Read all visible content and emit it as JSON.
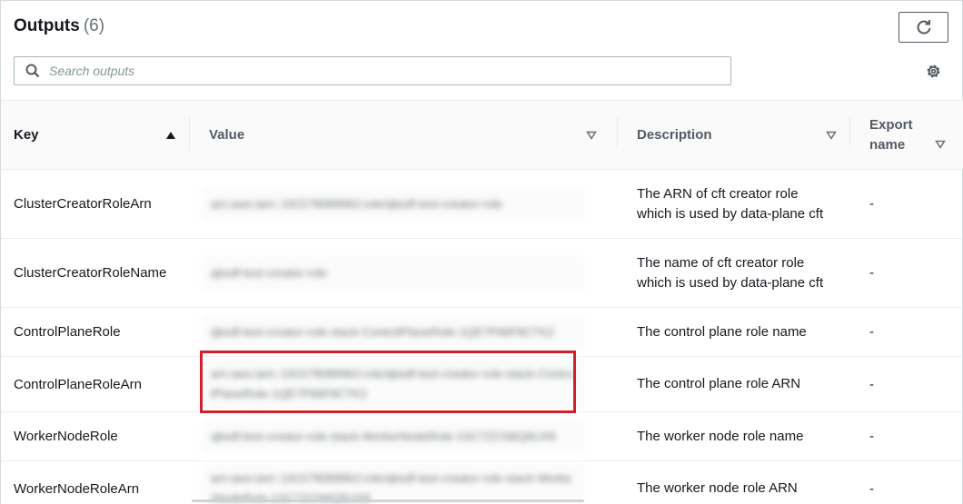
{
  "header": {
    "title": "Outputs",
    "count": "(6)"
  },
  "search": {
    "placeholder": "Search outputs",
    "value": ""
  },
  "icons": {
    "refresh": "refresh-icon",
    "search": "search-icon",
    "settings": "gear-icon",
    "sort_asc": "caret-up-icon",
    "sort_none": "caret-down-outline-icon"
  },
  "colors": {
    "highlight": "#d0202c",
    "header_bg": "#fafafa",
    "text": "#16191f",
    "muted": "#545b64"
  },
  "table": {
    "columns": [
      {
        "label": "Key",
        "sort": "ascending"
      },
      {
        "label": "Value",
        "sort": "none"
      },
      {
        "label": "Description",
        "sort": "none"
      },
      {
        "label": "Export name",
        "sort": "none"
      }
    ],
    "rows": [
      {
        "key": "ClusterCreatorRoleArn",
        "value": "arn:aws:iam::191578089962:role/qbsdf-test-creator-role",
        "description": "The ARN of cft creator role which is used by data-plane cft",
        "export": "-"
      },
      {
        "key": "ClusterCreatorRoleName",
        "value": "qbsdf-test-creator-role",
        "description": "The name of cft creator role which is used by data-plane cft",
        "export": "-"
      },
      {
        "key": "ControlPlaneRole",
        "value": "qbsdf-test-creator-role-stack-ControlPlaneRole-1QE7P66F8CTK2",
        "description": "The control plane role name",
        "export": "-"
      },
      {
        "key": "ControlPlaneRoleArn",
        "value": "arn:aws:iam::191578089962:role/qbsdf-test-creator-role-stack-ControlPlaneRole-1QE7P66F8CTK2",
        "description": "The control plane role ARN",
        "export": "-"
      },
      {
        "key": "WorkerNodeRole",
        "value": "qbsdf-test-creator-role-stack-WorkerNodeRole-1SC7ZCN6Q6UX8",
        "description": "The worker node role name",
        "export": "-"
      },
      {
        "key": "WorkerNodeRoleArn",
        "value": "arn:aws:iam::191578089962:role/qbsdf-test-creator-role-stack-WorkerNodeRole-1SC7ZCN6Q6UX8",
        "description": "The worker node role ARN",
        "export": "-"
      }
    ]
  }
}
